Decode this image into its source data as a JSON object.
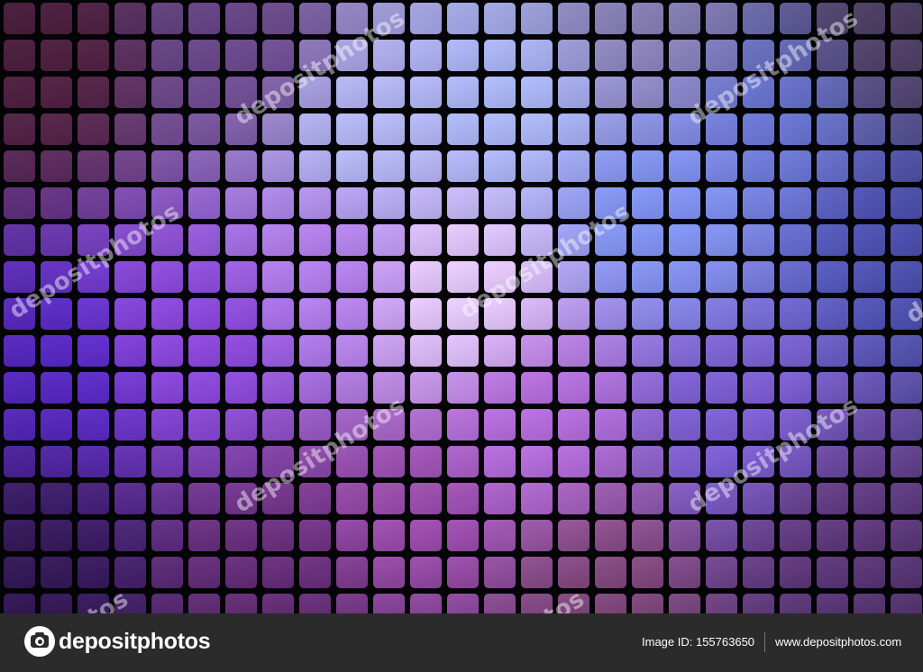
{
  "image": {
    "description": "Abstract mosaic background of rounded square tiles in violet, lilac, blue and pink gradient on black grid",
    "colors": {
      "center_highlight": "#e4c8f7",
      "upper_right_blue": "#7d95ee",
      "left_violet": "#5a2bc8",
      "bottom_mauve": "#8a4a8a",
      "corner_dark": "#3a1a30",
      "grout": "#050508"
    }
  },
  "watermarks": [
    {
      "text": "depositphotos"
    },
    {
      "text": "depositphotos"
    },
    {
      "text": "depositphotos"
    },
    {
      "text": "depositphotos"
    },
    {
      "text": "depositphotos"
    },
    {
      "text": "depositphotos"
    },
    {
      "text": "tos"
    },
    {
      "text": "tos"
    },
    {
      "text": "dep"
    }
  ],
  "footer": {
    "logo_icon": "camera-icon",
    "brand": "depositphotos",
    "image_id": "Image ID: 155763650",
    "url": "www.depositphotos.com",
    "background": "#2b2b2b"
  }
}
